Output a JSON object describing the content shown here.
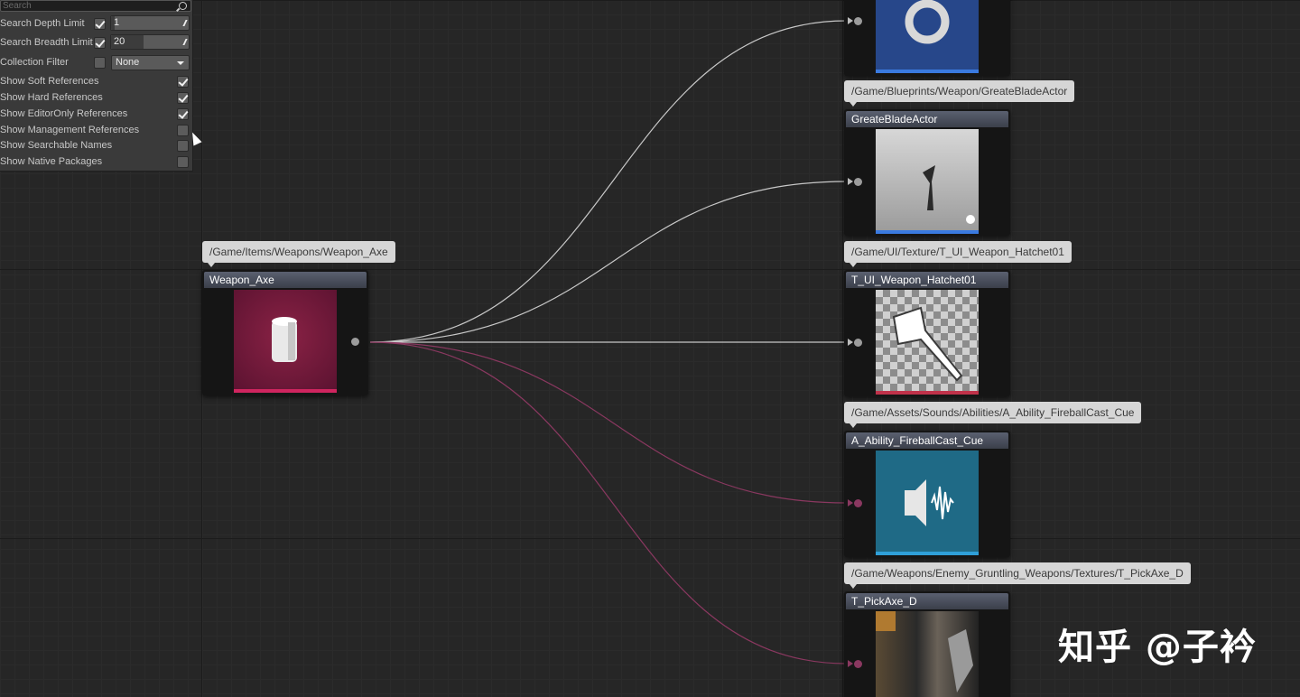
{
  "settings": {
    "search_placeholder": "Search",
    "depth": {
      "label": "Search Depth Limit",
      "checked": true,
      "value": "1"
    },
    "breadth": {
      "label": "Search Breadth Limit",
      "checked": true,
      "value": "20"
    },
    "collection": {
      "label": "Collection Filter",
      "checked": false,
      "value": "None"
    },
    "toggles": [
      {
        "label": "Show Soft References",
        "checked": true
      },
      {
        "label": "Show Hard References",
        "checked": true
      },
      {
        "label": "Show EditorOnly References",
        "checked": true
      },
      {
        "label": "Show Management References",
        "checked": false
      },
      {
        "label": "Show Searchable Names",
        "checked": false
      },
      {
        "label": "Show Native Packages",
        "checked": false
      }
    ]
  },
  "source_node": {
    "path": "/Game/Items/Weapons/Weapon_Axe",
    "title": "Weapon_Axe",
    "accent": "#d0255f"
  },
  "target_nodes": [
    {
      "path": "",
      "title": "",
      "accent": "#3a7ae0",
      "link": "hard"
    },
    {
      "path": "/Game/Blueprints/Weapon/GreateBladeActor",
      "title": "GreateBladeActor",
      "accent": "#3a7ae0",
      "link": "hard"
    },
    {
      "path": "/Game/UI/Texture/T_UI_Weapon_Hatchet01",
      "title": "T_UI_Weapon_Hatchet01",
      "accent": "#c0324a",
      "link": "hard"
    },
    {
      "path": "/Game/Assets/Sounds/Abilities/A_Ability_FireballCast_Cue",
      "title": "A_Ability_FireballCast_Cue",
      "accent": "#2f9fd8",
      "link": "soft"
    },
    {
      "path": "/Game/Weapons/Enemy_Gruntling_Weapons/Textures/T_PickAxe_D",
      "title": "T_PickAxe_D",
      "accent": "#b03040",
      "link": "soft"
    }
  ],
  "colors": {
    "hard_link": "#c8c8c8",
    "soft_link": "#8a3860"
  },
  "watermark": "知乎 @子衿"
}
